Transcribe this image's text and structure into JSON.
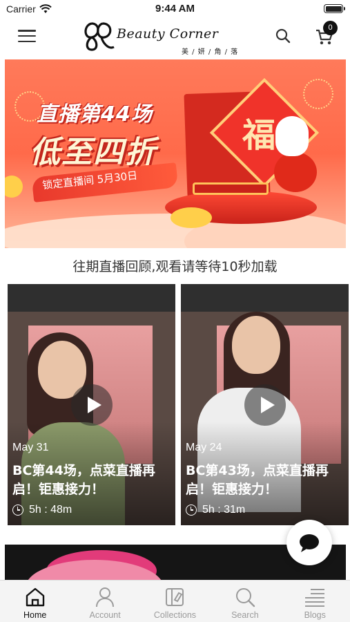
{
  "status_bar": {
    "carrier": "Carrier",
    "time": "9:44 AM"
  },
  "header": {
    "logo_text": "Beauty Corner",
    "logo_subtext": "美 / 妍 / 角 / 落",
    "cart_count": "0",
    "icons": [
      "menu-icon",
      "search-icon",
      "cart-icon"
    ]
  },
  "banner": {
    "title_line1": "直播第44场",
    "title_line2": "低至四折",
    "ribbon_text": "锁定直播间 5月30日",
    "fu_character": "福"
  },
  "section": {
    "title": "往期直播回顾,观看请等待10秒加载"
  },
  "videos": [
    {
      "date": "May 31",
      "title": "BC第44场，点菜直播再启！钜惠接力！",
      "duration": "5h : 48m"
    },
    {
      "date": "May 24",
      "title": "BC第43场，点菜直播再启！钜惠接力！",
      "duration": "5h : 31m"
    }
  ],
  "tabs": [
    {
      "label": "Home",
      "icon": "home-icon",
      "active": true
    },
    {
      "label": "Account",
      "icon": "account-icon",
      "active": false
    },
    {
      "label": "Collections",
      "icon": "collections-icon",
      "active": false
    },
    {
      "label": "Search",
      "icon": "search-icon",
      "active": false
    },
    {
      "label": "Blogs",
      "icon": "blogs-icon",
      "active": false
    }
  ],
  "colors": {
    "banner_red": "#ff6a4a",
    "active_tab": "#111111",
    "inactive_tab": "#9a9a9a"
  }
}
